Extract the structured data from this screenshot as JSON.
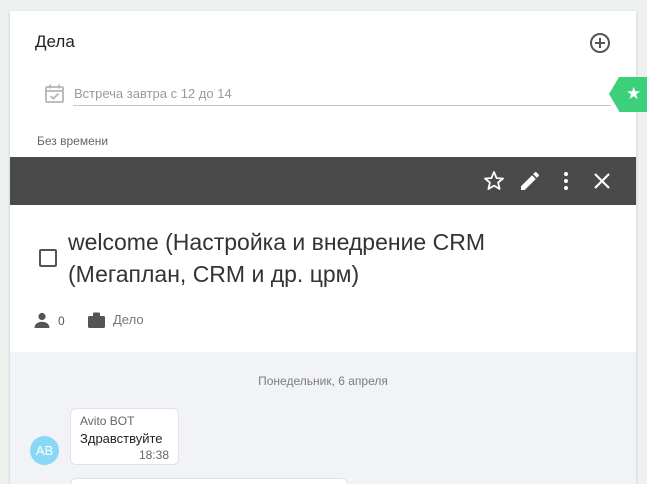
{
  "header": {
    "title": "Дела"
  },
  "new_task": {
    "placeholder": "Встреча завтра с 12 до 14",
    "value": ""
  },
  "section": {
    "label": "Без времени"
  },
  "task": {
    "title": "welcome (Настройка и внедрение CRM (Мегаплан, CRM и др. црм)",
    "participants_count": "0",
    "type_label": "Дело",
    "completed": false
  },
  "chat": {
    "day": "Понедельник, 6 апреля",
    "messages": [
      {
        "avatar": "AB",
        "sender": "Avito BOT",
        "text": "Здравствуйте",
        "time": "18:38"
      }
    ]
  },
  "colors": {
    "accent": "#3dd07b",
    "toolbar": "#4a4a4a",
    "avatar": "#8bd8f6"
  },
  "icons": {
    "add": "plus-circle-icon",
    "calendar": "calendar-check-icon",
    "favorite_tab": "star-icon",
    "toolbar": [
      "star-outline-icon",
      "pencil-icon",
      "more-vertical-icon",
      "close-icon"
    ],
    "participants": "person-icon",
    "type": "briefcase-icon"
  }
}
